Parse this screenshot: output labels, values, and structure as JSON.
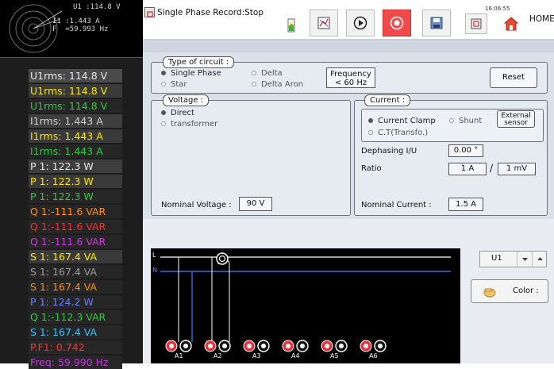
{
  "phasor": {
    "line1": "U1 :114.8 V",
    "line2": "I1 :1.443 A",
    "line3": "F  =59.993 Hz"
  },
  "measurements": [
    {
      "text": "U1rms: 114.8 V",
      "fg": "#e8e8e8",
      "bg": "#4a4a4a"
    },
    {
      "text": "U1rms: 114.8 V",
      "fg": "#ffe600",
      "bg": "#3a3a3a"
    },
    {
      "text": "U1rms: 114.8 V",
      "fg": "#2ecc40",
      "bg": "#262626"
    },
    {
      "text": "I1rms: 1.443 A",
      "fg": "#d0d0d0",
      "bg": "#3e3e3e"
    },
    {
      "text": "I1rms: 1.443 A",
      "fg": "#ffe600",
      "bg": "#3a3a3a"
    },
    {
      "text": "I1rms: 1.443 A",
      "fg": "#2ecc40",
      "bg": "#262626"
    },
    {
      "text": "P 1: 122.3 W",
      "fg": "#e8e8e8",
      "bg": "#3e3e3e"
    },
    {
      "text": "P 1: 122.3 W",
      "fg": "#ffe600",
      "bg": "#3a3a3a"
    },
    {
      "text": "P 1: 122.3 W",
      "fg": "#2ecc40",
      "bg": "#262626"
    },
    {
      "text": "Q 1:-111.6 VAR",
      "fg": "#ff8c1a",
      "bg": "#262626"
    },
    {
      "text": "Q 1:-111.6 VAR",
      "fg": "#ff2a2a",
      "bg": "#262626"
    },
    {
      "text": "Q 1:-111.6 VAR",
      "fg": "#c23bd8",
      "bg": "#262626"
    },
    {
      "text": "S 1: 167.4 VA",
      "fg": "#ffe600",
      "bg": "#3a3a3a"
    },
    {
      "text": "S 1: 167.4 VA",
      "fg": "#9c9c9c",
      "bg": "#262626"
    },
    {
      "text": "S 1: 167.4 VA",
      "fg": "#ff8c1a",
      "bg": "#262626"
    },
    {
      "text": "P 1: 124.2 W",
      "fg": "#6c7cff",
      "bg": "#262626"
    },
    {
      "text": "Q 1:-112.3 VAR",
      "fg": "#2ecc40",
      "bg": "#262626"
    },
    {
      "text": "S 1: 167.4 VA",
      "fg": "#3ec0ff",
      "bg": "#262626"
    },
    {
      "text": "P.F1: 0.742",
      "fg": "#ff3030",
      "bg": "#262626"
    },
    {
      "text": "Freq: 59.990 Hz",
      "fg": "#c23bd8",
      "bg": "#262626"
    }
  ],
  "toolbar": {
    "record_title": "Single Phase Record:Stop",
    "clock": "16:06:55",
    "home_label": "HOME"
  },
  "circuit": {
    "legend": "Type of circuit :",
    "options": [
      "Single Phase",
      "Delta",
      "Star",
      "Delta Aron"
    ],
    "selected": "Single Phase",
    "frequency_label": "Frequency\n< 60 Hz",
    "reset_label": "Reset"
  },
  "voltage": {
    "legend": "Voltage :",
    "options": [
      "Direct",
      "transformer"
    ],
    "selected": "Direct",
    "nominal_label": "Nominal Voltage :",
    "nominal_value": "90 V"
  },
  "current": {
    "legend": "Current       :",
    "options": [
      "Current Clamp",
      "Shunt",
      "C.T(Transfo.)"
    ],
    "selected": "Current Clamp",
    "external_sensor_label": "External sensor",
    "dephasing_label": "Dephasing I/U",
    "dephasing_value": "0.00 °",
    "ratio_label": "Ratio",
    "ratio_a": "1 A",
    "ratio_sep": "/",
    "ratio_b": "1 mV",
    "nominal_label": "Nominal Current :",
    "nominal_value": "1.5 A"
  },
  "wiring": {
    "line_l": "L",
    "line_n": "N",
    "terminals": [
      "A1",
      "A2",
      "A3",
      "A4",
      "A5",
      "A6"
    ]
  },
  "channel_select": {
    "value": "U1"
  },
  "color_button": {
    "label": "Color :"
  },
  "colors": {
    "panel_bg": "#dbe1ea",
    "accent_red": "#e8303a",
    "neutral_blue": "#2a5cd8"
  }
}
